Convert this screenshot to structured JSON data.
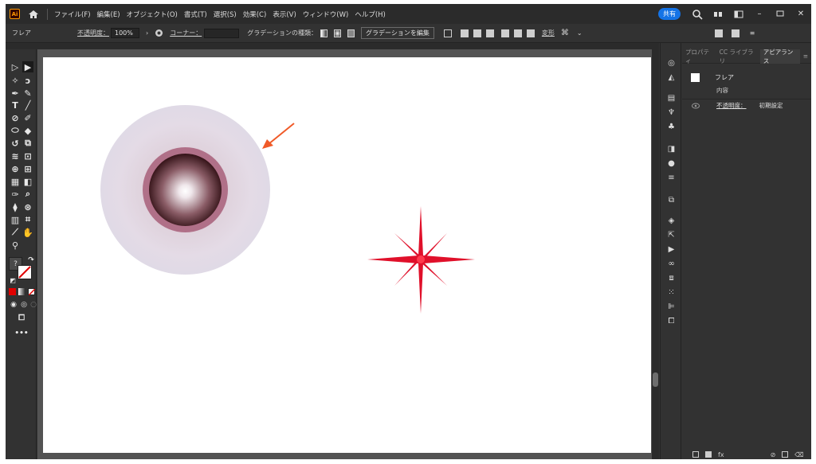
{
  "menubar": {
    "app_logo": "Ai",
    "items": [
      "ファイル(F)",
      "編集(E)",
      "オブジェクト(O)",
      "書式(T)",
      "選択(S)",
      "効果(C)",
      "表示(V)",
      "ウィンドウ(W)",
      "ヘルプ(H)"
    ],
    "share_label": "共有"
  },
  "controlbar": {
    "object_type": "フレア",
    "opacity_label": "不透明度：",
    "opacity_value": "100%",
    "corner_label": "コーナー：",
    "gradient_type_label": "グラデーションの種類：",
    "edit_gradient_button": "グラデーションを編集",
    "transform_label": "変形"
  },
  "panel": {
    "tabs": [
      "プロパティ",
      "CC ライブラリ",
      "アピアランス"
    ],
    "active_tab": "アピアランス",
    "object_name": "フレア",
    "contents_label": "内容",
    "opacity_label": "不透明度：",
    "opacity_value": "初期設定"
  },
  "colors": {
    "accent": "#1473e6",
    "star": "#e0102a",
    "arrow": "#f05a28"
  },
  "icons": {
    "home": "home-icon",
    "search": "search-icon",
    "visibility": "eye-icon"
  }
}
